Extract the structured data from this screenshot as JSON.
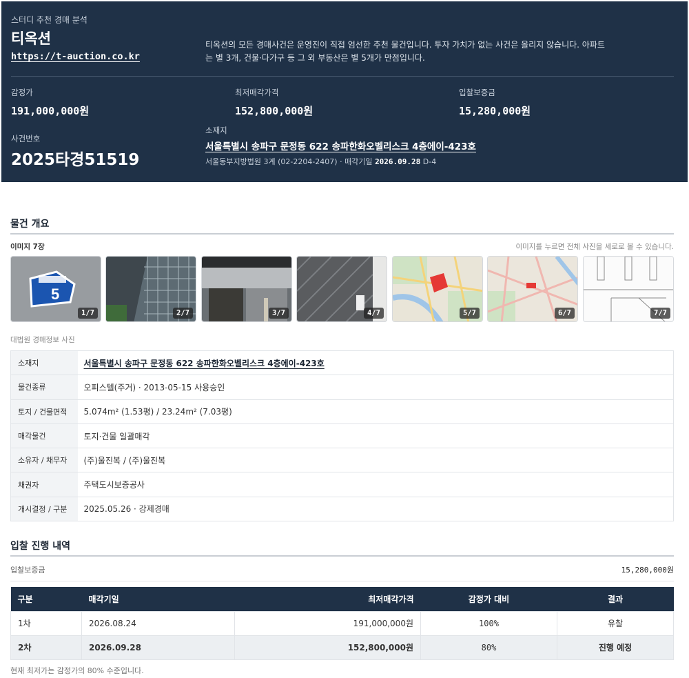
{
  "header": {
    "eyebrow": "스터디 추천 경매 분석",
    "brand": "티옥션",
    "url": "https://t-auction.co.kr",
    "intro": "티옥션의 모든 경매사건은 운영진이 직접 엄선한 추천 물건입니다. 투자 가치가 없는 사건은 올리지 않습니다. 아파트는 별 3개, 건물·다가구 등 그 외 부동산은 별 5개가 만점입니다.",
    "appraisal_label": "감정가",
    "appraisal_value": "191,000,000원",
    "min_price_label": "최저매각가격",
    "min_price_value": "152,800,000원",
    "deposit_label": "입찰보증금",
    "deposit_value": "15,280,000원",
    "case_label": "사건번호",
    "case_number": "2025타경51519",
    "address_label": "소재지",
    "address": "서울특별시 송파구 문정동 622 송파한화오벨리스크 4층에이-423호",
    "court_info": "서울동부지방법원 3계 (02-2204-2407) · 매각기일",
    "sale_date": "2026.09.28",
    "d_day": "D-4"
  },
  "overview": {
    "title": "물건 개요",
    "images_label": "이미지 7장",
    "images_hint": "이미지를 누르면 전체 사진을 세로로 볼 수 있습니다.",
    "thumbnails": [
      {
        "badge": "1/7",
        "sign_text": "5"
      },
      {
        "badge": "2/7"
      },
      {
        "badge": "3/7"
      },
      {
        "badge": "4/7"
      },
      {
        "badge": "5/7"
      },
      {
        "badge": "6/7"
      },
      {
        "badge": "7/7"
      }
    ],
    "source_caption": "대법원 경매정보 사진",
    "rows": [
      {
        "label": "소재지",
        "value": "서울특별시 송파구 문정동 622 송파한화오벨리스크 4층에이-423호"
      },
      {
        "label": "물건종류",
        "value": "오피스텔(주거) · 2013-05-15 사용승인"
      },
      {
        "label": "토지 / 건물면적",
        "value": "5.074m² (1.53평) / 23.24m² (7.03평)"
      },
      {
        "label": "매각물건",
        "value": "토지·건물 일괄매각"
      },
      {
        "label": "소유자 / 채무자",
        "value": "(주)울진복 / (주)울진복"
      },
      {
        "label": "채권자",
        "value": "주택도시보증공사"
      },
      {
        "label": "개시결정 / 구분",
        "value": "2025.05.26 · 강제경매"
      }
    ]
  },
  "bidding": {
    "title": "입찰 진행 내역",
    "deposit_label": "입찰보증금",
    "deposit_value": "15,280,000원",
    "columns": [
      "구분",
      "매각기일",
      "최저매각가격",
      "감정가 대비",
      "결과"
    ],
    "rows": [
      {
        "round": "1차",
        "date": "2026.08.24",
        "price": "191,000,000원",
        "ratio": "100%",
        "result": "유찰"
      },
      {
        "round": "2차",
        "date": "2026.09.28",
        "price": "152,800,000원",
        "ratio": "80%",
        "result": "진행 예정"
      }
    ],
    "footnote": "현재 최저가는 감정가의 80% 수준입니다.",
    "highlight_color": "#2e7d32"
  }
}
